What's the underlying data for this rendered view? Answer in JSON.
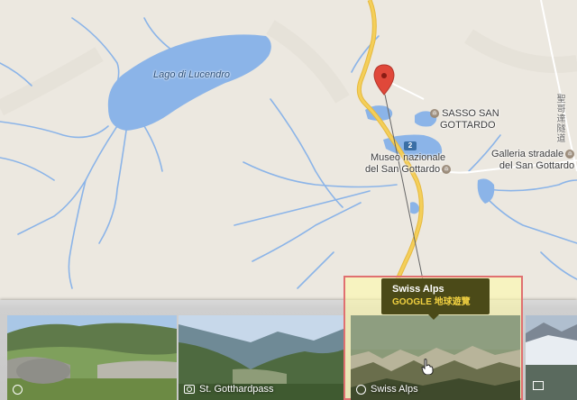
{
  "map": {
    "labels": {
      "lake": "Lago di Lucendro",
      "sasso_line1": "SASSO SAN",
      "sasso_line2": "GOTTARDO",
      "museo_line1": "Museo nazionale",
      "museo_line2": "del San Gottardo",
      "galleria_line1": "Galleria stradale",
      "galleria_line2": "del San Gottardo",
      "road_vertical": "聖哥達隧道",
      "route_shield": "2"
    },
    "colors": {
      "land": "#ece8e0",
      "water": "#8bb4e8",
      "highway": "#f4cf5a",
      "marker": "#e0483a"
    }
  },
  "tooltip": {
    "title": "Swiss Alps",
    "subtitle": "GOOGLE 地球遊覽"
  },
  "photo_strip": {
    "items": [
      {
        "caption": "",
        "icon": "globe-icon"
      },
      {
        "caption": "St. Gotthardpass",
        "icon": "camera-icon"
      },
      {
        "caption": "Swiss Alps",
        "icon": "globe-icon",
        "selected": true
      },
      {
        "caption": "",
        "icon": "video-icon"
      }
    ]
  }
}
